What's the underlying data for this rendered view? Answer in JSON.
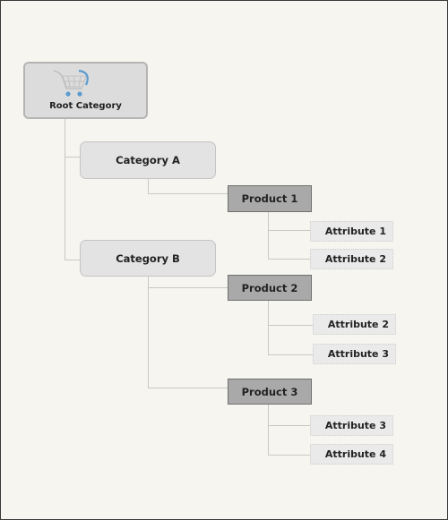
{
  "root": {
    "label": "Root Category",
    "icon": "shopping-cart-icon"
  },
  "categories": [
    {
      "label": "Category A",
      "products": [
        {
          "label": "Product 1",
          "attributes": [
            "Attribute 1",
            "Attribute 2"
          ]
        }
      ]
    },
    {
      "label": "Category B",
      "products": [
        {
          "label": "Product 2",
          "attributes": [
            "Attribute 2",
            "Attribute 3"
          ]
        },
        {
          "label": "Product 3",
          "attributes": [
            "Attribute 3",
            "Attribute 4"
          ]
        }
      ]
    }
  ],
  "colors": {
    "background": "#f6f5ef",
    "category": "#e3e3e3",
    "product": "#a9a9a9",
    "attribute": "#eaeaea",
    "cart_accent": "#5b9bd0"
  }
}
